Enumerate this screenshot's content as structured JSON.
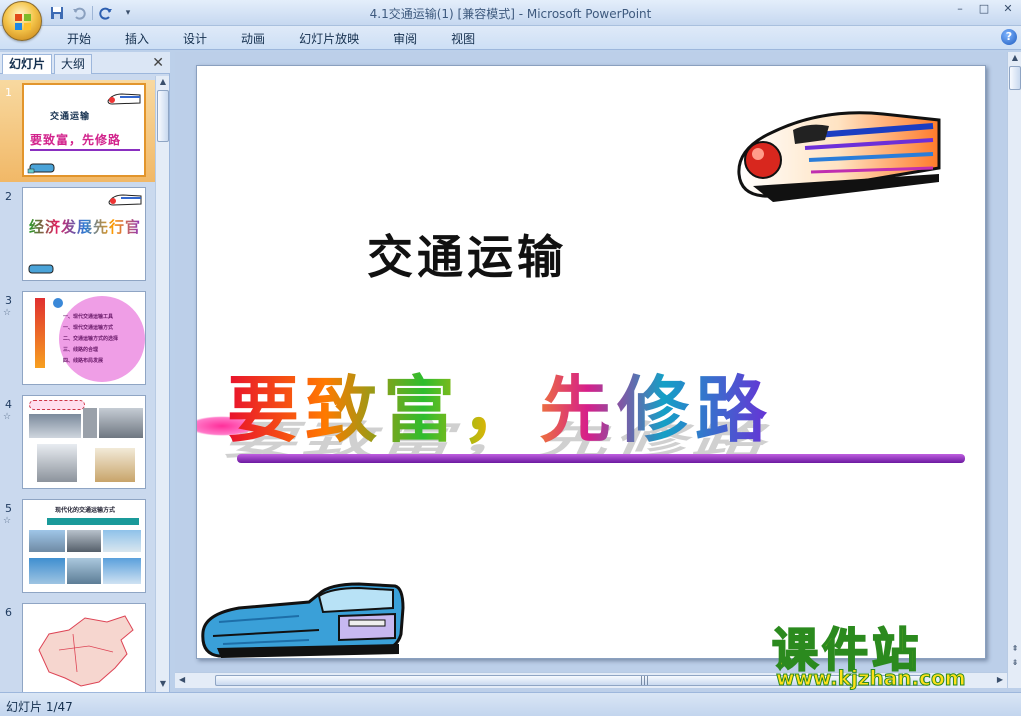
{
  "window": {
    "title": "4.1交通运输(1) [兼容模式]",
    "separator": " - ",
    "app_name": "Microsoft PowerPoint",
    "controls": [
      "minimize-icon",
      "restore-icon",
      "close-icon"
    ]
  },
  "ribbon": {
    "tabs": [
      "开始",
      "插入",
      "设计",
      "动画",
      "幻灯片放映",
      "审阅",
      "视图"
    ],
    "help_label": "?"
  },
  "left_pane": {
    "tabs": [
      "幻灯片",
      "大纲"
    ],
    "close_label": "✕",
    "thumbnails": [
      {
        "number": "1",
        "texts": [
          "交通运输",
          "要致富，先修路"
        ]
      },
      {
        "number": "2",
        "texts": [
          "经济发展先行官"
        ]
      },
      {
        "number": "3",
        "texts": [
          "一、现代交通运输工具",
          "一、现代交通运输方式",
          "二、交通运输方式的选择",
          "三、线路的合理",
          "四、线路布局发展"
        ]
      },
      {
        "number": "4",
        "texts": []
      },
      {
        "number": "5",
        "texts": [
          "现代化的交通运输方式"
        ]
      },
      {
        "number": "6",
        "texts": []
      }
    ]
  },
  "slide": {
    "title": "交通运输",
    "slogan": "要致富，先修路"
  },
  "status_bar": {
    "slide_indicator": "幻灯片 1/47"
  },
  "watermark": {
    "name": "课件站",
    "url": "www.kjzhan.com"
  },
  "colors": {
    "accent_selected": "#f1b867",
    "ribbon_bg": "#cddff5",
    "slogan_underline": "#8a2fc0"
  }
}
